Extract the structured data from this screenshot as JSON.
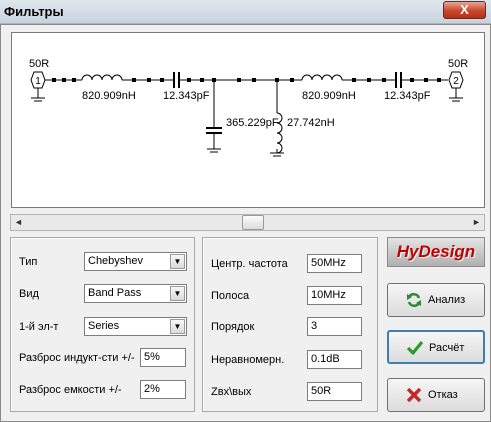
{
  "window": {
    "title": "Фильтры",
    "close_glyph": "X"
  },
  "schematic": {
    "source_port": {
      "impedance": "50R",
      "number": "1"
    },
    "load_port": {
      "impedance": "50R",
      "number": "2"
    },
    "components": {
      "series_inductor_1": "820.909nH",
      "series_capacitor_1": "12.343pF",
      "shunt_capacitor": "365.229pF",
      "shunt_inductor": "27.742nH",
      "series_inductor_2": "820.909nH",
      "series_capacitor_2": "12.343pF"
    }
  },
  "scrollbar": {
    "left_arrow": "◄",
    "right_arrow": "►"
  },
  "left_panel": {
    "type_label": "Тип",
    "type_value": "Chebyshev",
    "kind_label": "Вид",
    "kind_value": "Band Pass",
    "first_element_label": "1-й эл-т",
    "first_element_value": "Series",
    "inductance_spread_label": "Разброс индукт-сти +/-",
    "inductance_spread_value": "5%",
    "capacitance_spread_label": "Разброс емкости +/-",
    "capacitance_spread_value": "2%"
  },
  "right_panel": {
    "center_freq_label": "Центр. частота",
    "center_freq_value": "50MHz",
    "bandwidth_label": "Полоса",
    "bandwidth_value": "10MHz",
    "order_label": "Порядок",
    "order_value": "3",
    "ripple_label": "Неравномерн.",
    "ripple_value": "0.1dB",
    "impedance_label": "Zвх\\вых",
    "impedance_value": "50R"
  },
  "logo": {
    "text": "HyDesign"
  },
  "buttons": {
    "analyze": "Анализ",
    "calculate": "Расчёт",
    "cancel": "Отказ"
  },
  "icons": {
    "close": "close-icon",
    "analyze": "refresh-icon",
    "calculate": "checkmark-icon",
    "cancel": "cancel-x-icon",
    "dropdown": "chevron-down-icon"
  },
  "colors": {
    "close_button": "#c9462c",
    "logo": "#c00000",
    "analyze_icon": "#2e8b3a",
    "calculate_icon": "#2a9a2a",
    "cancel_icon": "#c62828"
  }
}
